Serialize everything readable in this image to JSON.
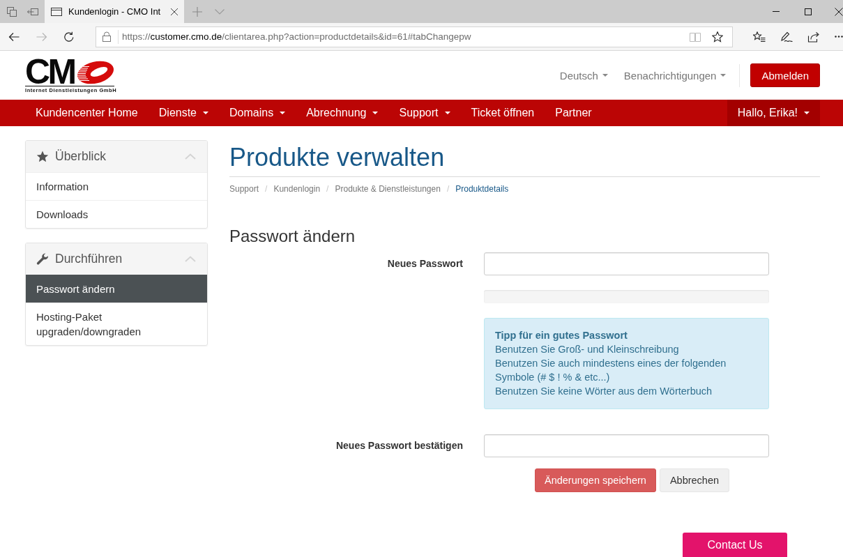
{
  "browser": {
    "tab_title": "Kundenlogin - CMO Int",
    "url": {
      "scheme": "https://",
      "host": "customer.cmo.de",
      "path": "/clientarea.php?action=productdetails&id=61#tabChangepw"
    },
    "forward_disabled": true
  },
  "header": {
    "logo": {
      "letters": "CM",
      "tagline": "Internet Dienstleistungen GmbH"
    },
    "menus": [
      {
        "label": "Deutsch",
        "dropdown": true
      },
      {
        "label": "Benachrichtigungen",
        "dropdown": true
      }
    ],
    "logout_button": "Abmelden"
  },
  "navbar": {
    "items": [
      {
        "label": "Kundencenter Home",
        "dropdown": false
      },
      {
        "label": "Dienste",
        "dropdown": true
      },
      {
        "label": "Domains",
        "dropdown": true
      },
      {
        "label": "Abrechnung",
        "dropdown": true
      },
      {
        "label": "Support",
        "dropdown": true
      },
      {
        "label": "Ticket öffnen",
        "dropdown": false
      },
      {
        "label": "Partner",
        "dropdown": false
      }
    ],
    "account": {
      "label": "Hallo, Erika!",
      "dropdown": true
    }
  },
  "sidebar": [
    {
      "title": "Überblick",
      "expanded": true,
      "items": [
        {
          "label": "Information",
          "selected": false
        },
        {
          "label": "Downloads",
          "selected": false
        }
      ]
    },
    {
      "title": "Durchführen",
      "expanded": true,
      "items": [
        {
          "label": "Passwort ändern",
          "selected": true
        },
        {
          "label": "Hosting-Paket upgraden/downgraden",
          "selected": false
        }
      ]
    }
  ],
  "page": {
    "title": "Produkte verwalten",
    "breadcrumb": [
      {
        "label": "Support",
        "selected": false,
        "separator": "/"
      },
      {
        "label": "Kundenlogin",
        "selected": false,
        "separator": "/"
      },
      {
        "label": "Produkte & Dienstleistungen",
        "selected": false,
        "separator": "/"
      },
      {
        "label": "Produktdetails",
        "selected": true
      }
    ],
    "section_title": "Passwort ändern",
    "form": {
      "new_password": {
        "label": "Neues Passwort"
      },
      "strength": {
        "level": 0
      },
      "tip": {
        "title": "Tipp für ein gutes Passwort",
        "lines": [
          "Benutzen Sie Groß- und Kleinschreibung",
          "Benutzen Sie auch mindestens eines der folgenden Symbole (# $ ! % & etc...)",
          "Benutzen Sie keine Wörter aus dem Wörterbuch"
        ]
      },
      "confirm_password": {
        "label": "Neues Passwort bestätigen"
      },
      "buttons": [
        {
          "label": "Änderungen speichern",
          "kind": "primary"
        },
        {
          "label": "Abbrechen",
          "kind": "default"
        }
      ]
    }
  },
  "contact_button": "Contact Us"
}
